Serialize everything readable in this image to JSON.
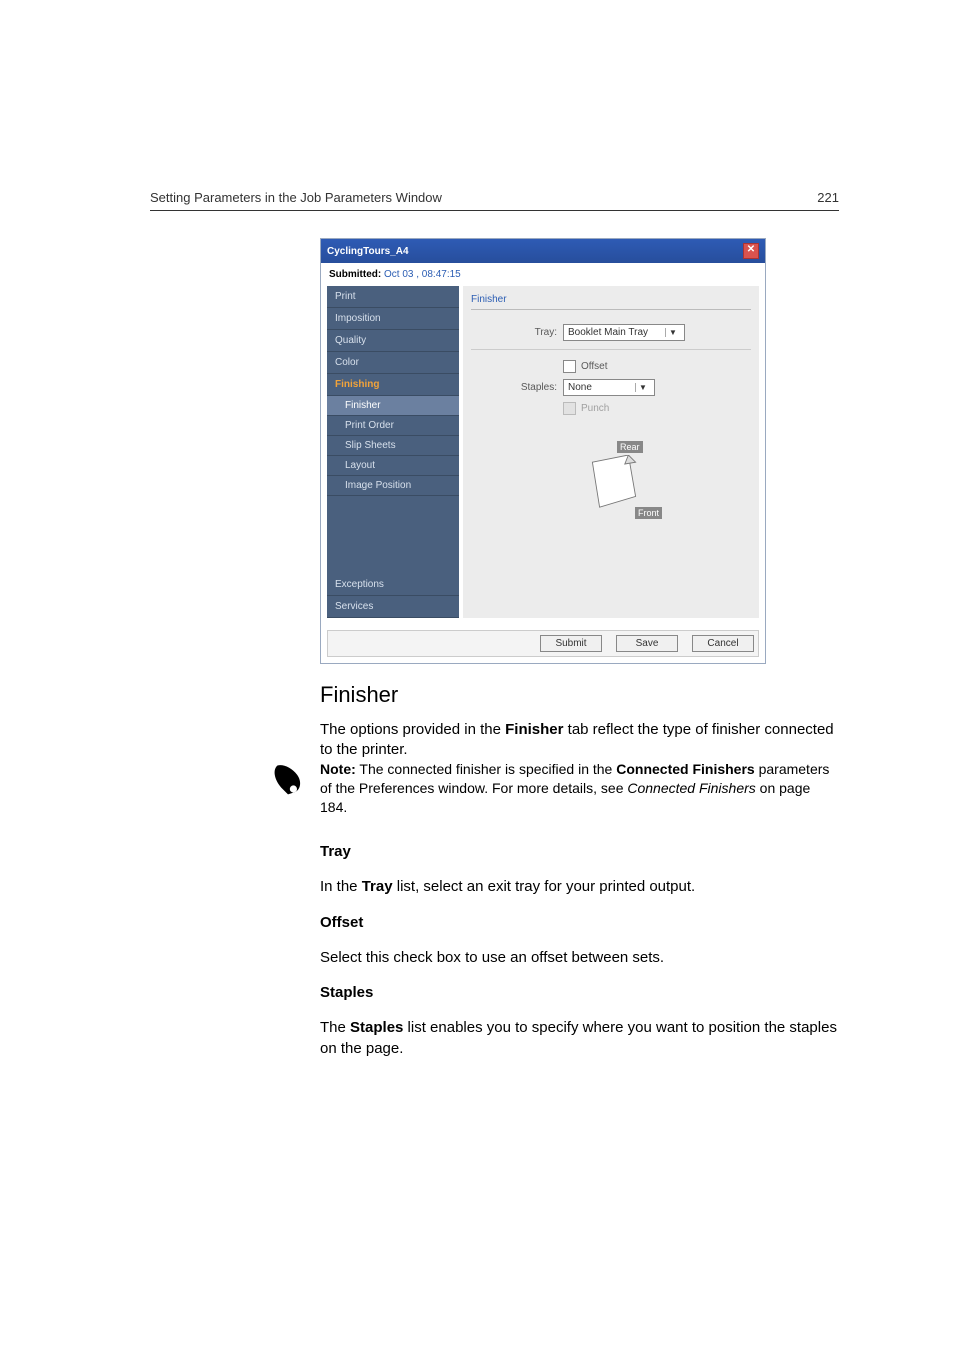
{
  "page": {
    "header_left": "Setting Parameters in the Job Parameters Window",
    "header_right": "221"
  },
  "dialog": {
    "title": "CyclingTours_A4",
    "submitted_label": "Submitted:",
    "submitted_value": "Oct 03 , 08:47:15",
    "sidebar": {
      "print": "Print",
      "imposition": "Imposition",
      "quality": "Quality",
      "color": "Color",
      "finishing": "Finishing",
      "finisher": "Finisher",
      "print_order": "Print Order",
      "slip_sheets": "Slip Sheets",
      "layout": "Layout",
      "image_position": "Image Position",
      "exceptions": "Exceptions",
      "services": "Services"
    },
    "panel": {
      "title": "Finisher",
      "tray_label": "Tray:",
      "tray_value": "Booklet Main Tray",
      "offset_label": "Offset",
      "staples_label": "Staples:",
      "staples_value": "None",
      "punch_label": "Punch",
      "rear_label": "Rear",
      "front_label": "Front"
    },
    "buttons": {
      "submit": "Submit",
      "save": "Save",
      "cancel": "Cancel"
    }
  },
  "body": {
    "h2": "Finisher",
    "intro_a": "The options provided in the ",
    "intro_bold": "Finisher",
    "intro_b": " tab reflect the type of finisher connected to the printer.",
    "note_label": "Note:",
    "note_a": "  The connected finisher is specified in the ",
    "note_bold": "Connected Finishers",
    "note_b": " parameters of the Preferences window. For more details, see ",
    "note_italic": "Connected Finishers",
    "note_c": " on page 184.",
    "tray_head": "Tray",
    "tray_a": "In the ",
    "tray_bold": "Tray",
    "tray_b": " list, select an exit tray for your printed output.",
    "offset_head": "Offset",
    "offset_text": "Select this check box to use an offset between sets.",
    "staples_head": "Staples",
    "staples_a": "The ",
    "staples_bold": "Staples",
    "staples_b": " list enables you to specify where you want to position the staples on the page."
  }
}
